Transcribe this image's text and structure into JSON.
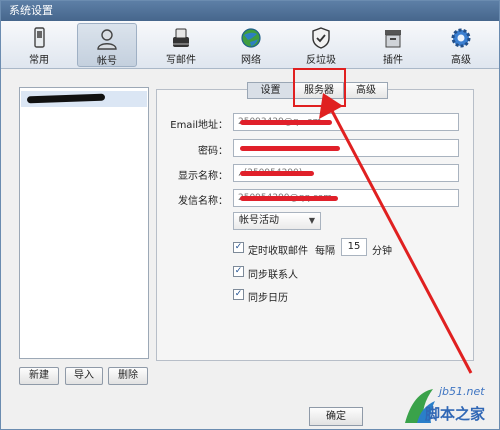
{
  "window": {
    "title": "系统设置"
  },
  "toolbar": {
    "items": [
      {
        "label": "常用",
        "icon": "phone-icon"
      },
      {
        "label": "帐号",
        "icon": "user-icon"
      },
      {
        "label": "写邮件",
        "icon": "compose-icon"
      },
      {
        "label": "网络",
        "icon": "globe-icon"
      },
      {
        "label": "反垃圾",
        "icon": "shield-icon"
      },
      {
        "label": "插件",
        "icon": "plugin-box-icon"
      },
      {
        "label": "高级",
        "icon": "gear-icon"
      }
    ],
    "active": "帐号"
  },
  "tabs": [
    {
      "label": "设置"
    },
    {
      "label": "服务器"
    },
    {
      "label": "高级"
    }
  ],
  "form": {
    "email_label": "Email地址：",
    "email_value": "25093429@q...om",
    "password_label": "密码：",
    "display_label": "显示名称：",
    "display_value": ",,(250954290)",
    "sender_label": "发信名称：",
    "sender_value": "250954290@qq.com",
    "account_status": "帐号活动",
    "timed_fetch_label": "定时收取邮件",
    "interval_prefix": "每隔",
    "interval_value": "15",
    "interval_unit": "分钟",
    "sync_contacts": "同步联系人",
    "sync_calendar": "同步日历"
  },
  "left_buttons": {
    "new": "新建",
    "import": "导入",
    "delete": "删除"
  },
  "footer": {
    "ok": "确定"
  },
  "watermark": {
    "url": "jb51.net",
    "text": "脚本之家"
  },
  "colors": {
    "accent": "#e02020",
    "title_bar": "#4f719a",
    "selection": "#dbe6f4"
  }
}
